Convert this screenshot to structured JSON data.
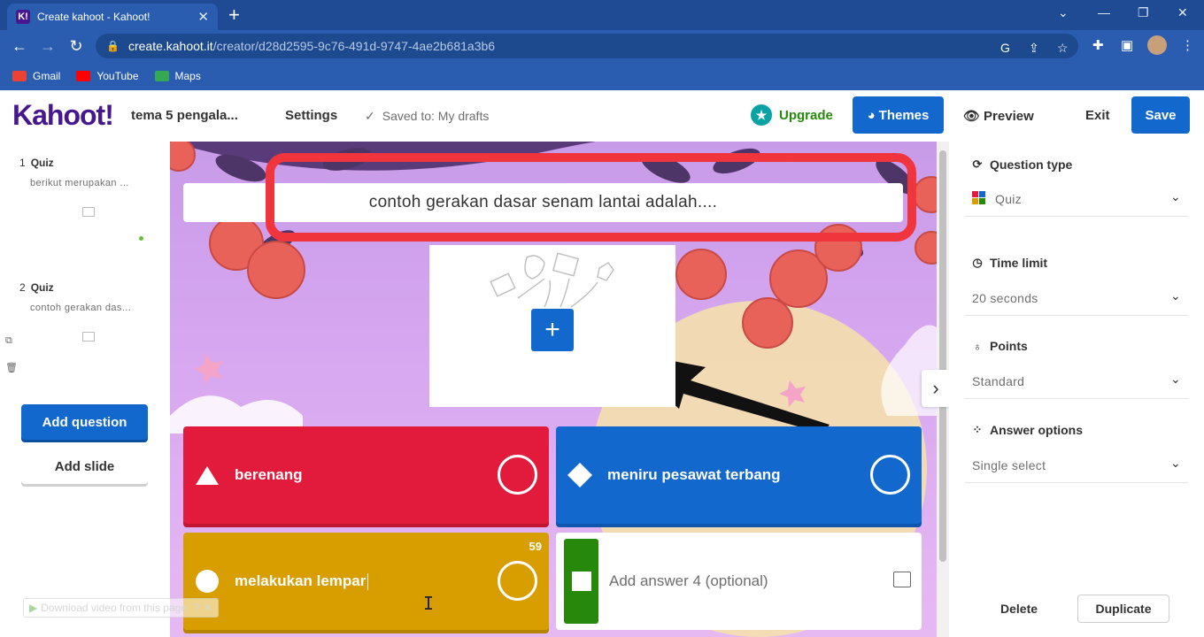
{
  "browser": {
    "tab_title": "Create kahoot - Kahoot!",
    "url_host": "create.kahoot.it",
    "url_path": "/creator/d28d2595-9c76-491d-9747-4ae2b681a3b6",
    "bookmarks": [
      {
        "label": "Gmail",
        "color": "#ea4335"
      },
      {
        "label": "YouTube",
        "color": "#ff0000"
      },
      {
        "label": "Maps",
        "color": "#34a853"
      }
    ]
  },
  "header": {
    "logo": "Kahoot!",
    "quiz_title": "tema 5 pengala...",
    "settings": "Settings",
    "saved_status": "Saved to: My drafts",
    "upgrade": "Upgrade",
    "themes": "Themes",
    "preview": "Preview",
    "exit": "Exit",
    "save": "Save"
  },
  "sidebar": {
    "slides": [
      {
        "number": "1",
        "type": "Quiz",
        "preview": "berikut merupakan ...",
        "selected": false
      },
      {
        "number": "2",
        "type": "Quiz",
        "preview": "contoh gerakan das...",
        "selected": true
      }
    ],
    "add_question": "Add question",
    "add_slide": "Add slide"
  },
  "editor": {
    "question": "contoh gerakan dasar senam lantai adalah....",
    "answers": [
      {
        "text": "berenang",
        "shape": "triangle",
        "color": "#e21b3c"
      },
      {
        "text": "meniru pesawat terbang",
        "shape": "diamond",
        "color": "#1368ce"
      },
      {
        "text": "melakukan lempar",
        "shape": "circle",
        "color": "#d89e00",
        "char_counter": "59"
      },
      {
        "placeholder": "Add answer 4 (optional)",
        "shape": "square",
        "color": "#26890c"
      }
    ]
  },
  "right_panel": {
    "question_type": {
      "label": "Question type",
      "value": "Quiz"
    },
    "time_limit": {
      "label": "Time limit",
      "value": "20 seconds"
    },
    "points": {
      "label": "Points",
      "value": "Standard"
    },
    "answer_options": {
      "label": "Answer options",
      "value": "Single select"
    },
    "delete": "Delete",
    "duplicate": "Duplicate"
  },
  "overlay": {
    "download_text": "Download video from this page"
  }
}
